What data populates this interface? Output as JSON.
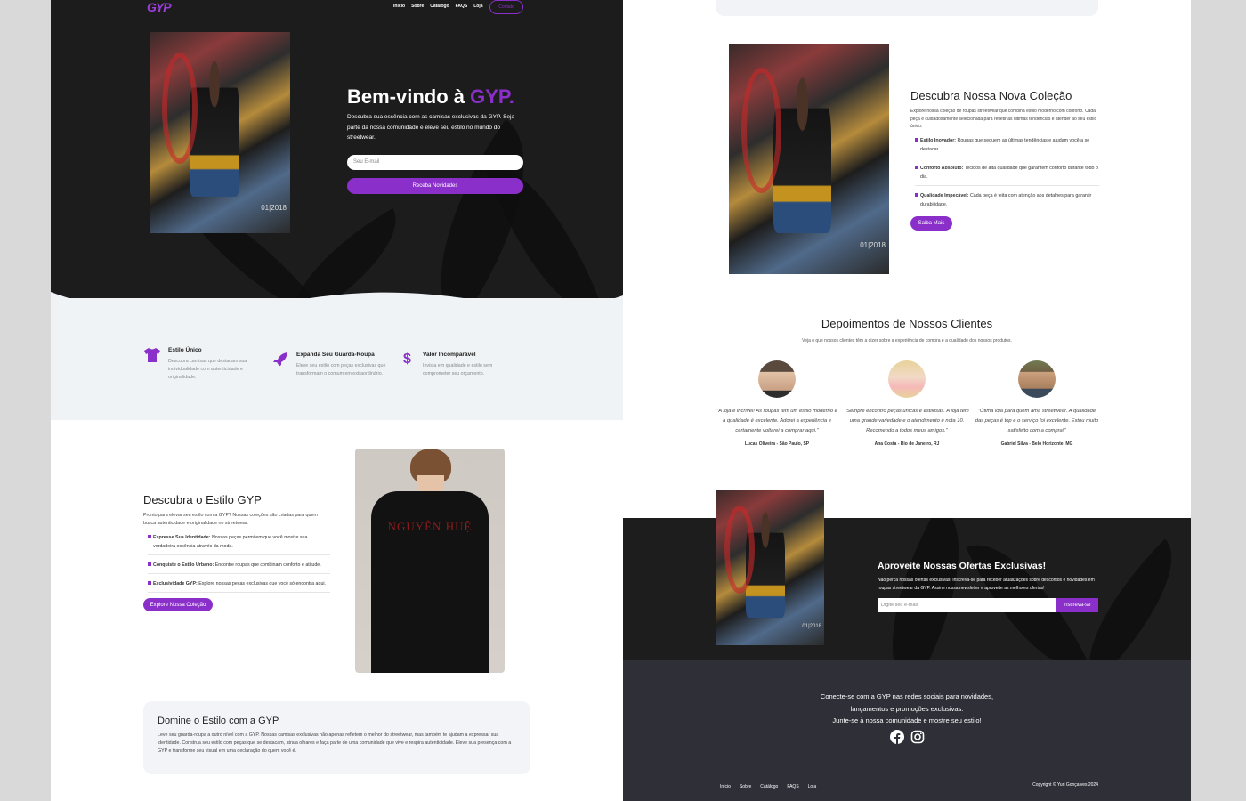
{
  "nav": {
    "logo": "GYP",
    "items": [
      "Início",
      "Sobre",
      "Catálogo",
      "FAQS",
      "Loja"
    ],
    "contact_label": "Contato"
  },
  "hero": {
    "title_prefix": "Bem-vindo à ",
    "title_brand": "GYP.",
    "text": "Descubra sua essência com as camisas exclusivas da GYP. Seja parte da nossa comunidade e eleve seu estilo no mundo do streetwear.",
    "email_placeholder": "Seu E-mail",
    "button": "Receba Novidades"
  },
  "features": [
    {
      "icon": "tshirt-icon",
      "title": "Estilo Único",
      "desc": "Descubra camisas que destacam sua individualidade com autenticidade e originalidade."
    },
    {
      "icon": "rocket-icon",
      "title": "Expanda Seu Guarda-Roupa",
      "desc": "Eleve seu estilo com peças exclusivas que transformam o comum em extraordinário."
    },
    {
      "icon": "dollar-icon",
      "title": "Valor Incomparável",
      "desc": "Invista em qualidade e estilo sem comprometer seu orçamento."
    }
  ],
  "estilo": {
    "title": "Descubra o Estilo GYP",
    "intro": "Pronto para elevar seu estilo com a GYP? Nossas coleções são criadas para quem busca autenticidade e originalidade no streetwear.",
    "items": [
      {
        "bold": "Expresse Sua Identidade:",
        "text": " Nossas peças permitem que você mostre sua verdadeira essência através da moda."
      },
      {
        "bold": "Conquiste o Estilo Urbano:",
        "text": " Encontre roupas que combinam conforto e atitude."
      },
      {
        "bold": "Exclusividade GYP:",
        "text": " Explore nossas peças exclusivas que você só encontra aqui."
      }
    ],
    "button": "Explore Nossa Coleção",
    "shirt_print": "NGUYỄN HUỆ"
  },
  "domine": {
    "title": "Domine o Estilo com a GYP",
    "text": "Leve seu guarda-roupa a outro nível com a GYP. Nossas camisas exclusivas não apenas refletem o melhor do streetwear, mas também te ajudam a expressar sua identidade. Construa seu estilo com peças que se destacam, atraia olhares e faça parte de uma comunidade que vive e respira autenticidade. Eleve sua presença com a GYP e transforme seu visual em uma declaração do quem você é."
  },
  "colecao": {
    "title": "Descubra Nossa Nova Coleção",
    "intro": "Explore nossa coleção de roupas streetwear que combina estilo moderno com conforto. Cada peça é cuidadosamente selecionada para refletir as últimas tendências e atender ao seu estilo único.",
    "items": [
      {
        "bold": "Estilo Inovador:",
        "text": " Roupas que seguem as últimas tendências e ajudam você a se destacar."
      },
      {
        "bold": "Conforto Absoluto:",
        "text": " Tecidos de alta qualidade que garantem conforto durante todo o dia."
      },
      {
        "bold": "Qualidade Impecável:",
        "text": " Cada peça é feita com atenção aos detalhes para garantir durabilidade."
      }
    ],
    "button": "Saiba Mais"
  },
  "depoimentos": {
    "title": "Depoimentos de Nossos Clientes",
    "subtitle": "Veja o que nossos clientes têm a dizer sobre a experiência de compra e a qualidade dos nossos produtos.",
    "items": [
      {
        "quote": "\"A loja é incrível! As roupas têm um estilo moderno e a qualidade é excelente. Adorei a experiência e certamente voltarei a comprar aqui.\"",
        "author": "Lucas Oliveira - São Paulo, SP"
      },
      {
        "quote": "\"Sempre encontro peças únicas e estilosas. A loja tem uma grande variedade e o atendimento é nota 10. Recomendo a todos meus amigos.\"",
        "author": "Ana Costa - Rio de Janeiro, RJ"
      },
      {
        "quote": "\"Ótima loja para quem ama streetwear. A qualidade das peças é top e o serviço foi excelente. Estou muito satisfeito com a compra!\"",
        "author": "Gabriel Silva - Belo Horizonte, MG"
      }
    ]
  },
  "promo": {
    "title": "Aproveite Nossas Ofertas Exclusivas!",
    "text": "Não perca nossas ofertas exclusivas! Inscreva-se para receber atualizações sobre descontos e novidades em roupas streetwear da GYP. Assine nossa newsletter e aproveite as melhores ofertas!",
    "placeholder": "Digite seu e-mail",
    "button": "Inscreva-se"
  },
  "footer": {
    "line1": "Conecte-se com a GYP nas redes sociais para novidades,",
    "line2": "lançamentos e promoções exclusivas.",
    "line3": "Junte-se à nossa comunidade e mostre seu estilo!",
    "links": [
      "Início",
      "Sobre",
      "Catálogo",
      "FAQS",
      "Loja"
    ],
    "copyright": "Copyright © Yuri Gonçalves 2024"
  },
  "photo_caption": "01|2018"
}
